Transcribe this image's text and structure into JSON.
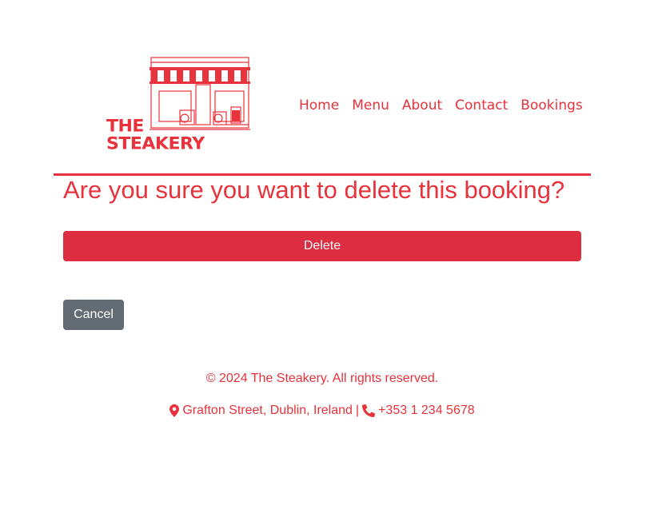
{
  "brand": {
    "logo_line1": "THE",
    "logo_line2": "STEAKERY"
  },
  "nav": {
    "items": [
      "Home",
      "Menu",
      "About",
      "Contact",
      "Bookings"
    ]
  },
  "page": {
    "title": "Are you sure you want to delete this booking?",
    "delete_label": "Delete",
    "cancel_label": "Cancel"
  },
  "footer": {
    "copyright": "© 2024 The Steakery. All rights reserved.",
    "address": "Grafton Street, Dublin, Ireland",
    "separator": "|",
    "phone": "+353 1 234 5678",
    "location_icon": "map-marker-icon",
    "phone_icon": "phone-icon"
  },
  "colors": {
    "brand_red": "#e8323c",
    "danger": "#dc2e40",
    "secondary": "#626b73"
  }
}
